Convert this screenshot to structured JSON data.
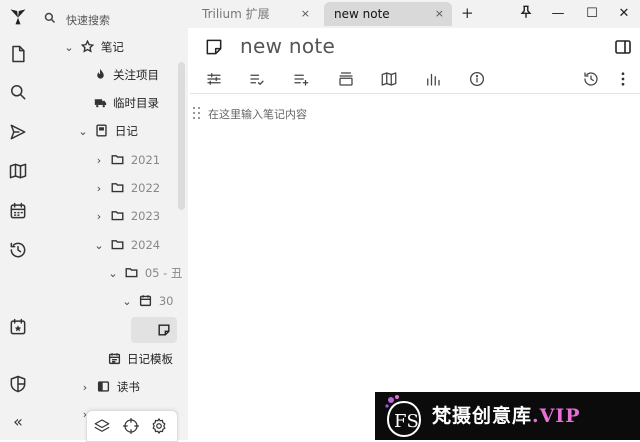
{
  "launcher": {
    "icons": [
      "trilium-logo-icon",
      "new-note-icon",
      "search-icon",
      "send-icon",
      "map-icon",
      "calendar-icon",
      "history-icon",
      "today-calendar-icon",
      "shield-icon",
      "collapse-icon"
    ]
  },
  "tree": {
    "search_placeholder": "快速搜索",
    "nodes": {
      "notes": "笔记",
      "watched": "关注项目",
      "temp": "临时目录",
      "journal": "日记",
      "y2021": "2021",
      "y2022": "2022",
      "y2023": "2023",
      "y2024": "2024",
      "month": "05 - 丑",
      "day": "30",
      "template": "日记模板",
      "reading": "读书",
      "hidden": "..."
    }
  },
  "tabs": [
    {
      "label": "Trilium 扩展",
      "close": "×"
    },
    {
      "label": "new note",
      "close": "×"
    }
  ],
  "new_tab": "+",
  "window": {
    "minimize": "—",
    "maximize": "☐",
    "close": "✕"
  },
  "note": {
    "title": "new note",
    "placeholder": "在这里输入笔记内容"
  },
  "watermark": {
    "logo_text": "FS",
    "brand": "梵摄创意库",
    "suffix": ".VIP"
  },
  "colors": {
    "sidebar_bg": "#f2f2f2",
    "active_tab": "#d9d9d9",
    "active_node": "#e2e2e2",
    "watermark_accent": "#e96fd7"
  }
}
